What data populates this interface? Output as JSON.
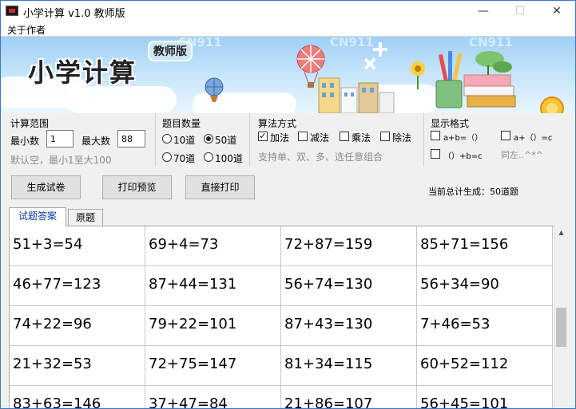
{
  "window": {
    "title": "小学计算 v1.0 教师版"
  },
  "menu": {
    "about": "关于作者"
  },
  "banner": {
    "title": "小学计算",
    "edition": "教师版",
    "watermarks": [
      "CN911",
      "CN911",
      "CN911"
    ]
  },
  "range": {
    "title": "计算范围",
    "min_label": "最小数",
    "min_value": "1",
    "max_label": "最大数",
    "max_value": "88",
    "hint": "默认空，最小1至大100"
  },
  "count": {
    "title": "题目数量",
    "options": [
      "10道",
      "50道",
      "70道",
      "100道"
    ],
    "selected": "50道"
  },
  "operations": {
    "title": "算法方式",
    "options": [
      "加法",
      "减法",
      "乘法",
      "除法"
    ],
    "checked": [
      "加法"
    ],
    "hint": "支持单、双、多、选任意组合"
  },
  "format": {
    "title": "显示格式",
    "opt1": "a+b=（）",
    "opt2": "a+（）=c",
    "opt3": "（）+b=c",
    "hint": "同左..^*^"
  },
  "actions": {
    "generate": "生成试卷",
    "preview": "打印预览",
    "print": "直接打印"
  },
  "status": {
    "total": "当前总计生成：50道题"
  },
  "tabs": {
    "answers": "试题答案",
    "original": "原题"
  },
  "problems": [
    [
      "51+3=54",
      "69+4=73",
      "72+87=159",
      "85+71=156"
    ],
    [
      "46+77=123",
      "87+44=131",
      "56+74=130",
      "56+34=90"
    ],
    [
      "74+22=96",
      "79+22=101",
      "87+43=130",
      "7+46=53"
    ],
    [
      "21+32=53",
      "72+75=147",
      "81+34=115",
      "60+52=112"
    ],
    [
      "83+63=146",
      "37+47=84",
      "21+86=107",
      "56+45=101"
    ]
  ]
}
